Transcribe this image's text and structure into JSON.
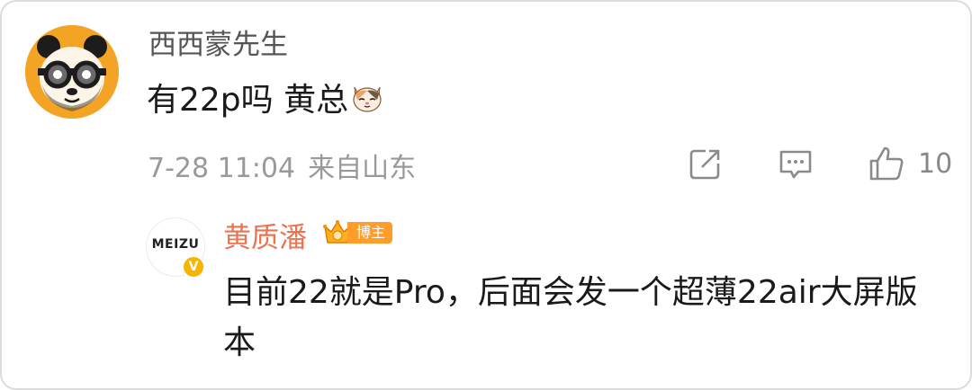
{
  "comment": {
    "avatar_icon": "panda-with-glasses-avatar-icon",
    "username": "西西蒙先生",
    "text": "有22p吗 黄总",
    "emoji": "cat-face-emoji-icon",
    "time": "7-28 11:04",
    "location": "来自山东",
    "actions": {
      "share_icon": "share-icon",
      "reply_icon": "comment-icon",
      "like_icon": "thumbs-up-icon",
      "like_count": "10"
    }
  },
  "reply": {
    "avatar_brand": "MEIZU",
    "verified_icon": "verified-v-icon",
    "verified_mark": "V",
    "username": "黄质潘",
    "badge_icon": "crown-icon",
    "badge_label": "博主",
    "text": "目前22就是Pro，后面会发一个超薄22air大屏版本"
  },
  "colors": {
    "username_gray": "#555555",
    "meta_gray": "#999999",
    "reply_username_orange": "#eb7350",
    "badge_orange": "#ff9d2b",
    "verified_gold": "#f7b500",
    "avatar_orange": "#f3a424"
  }
}
